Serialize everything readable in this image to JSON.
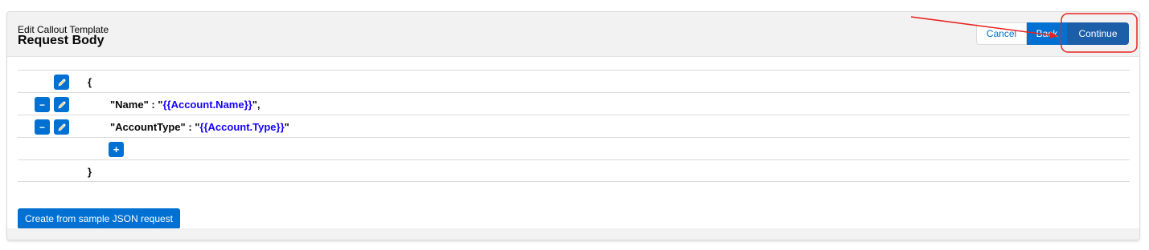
{
  "header": {
    "eyebrow": "Edit Callout Template",
    "title": "Request Body"
  },
  "actions": {
    "cancel_label": "Cancel",
    "back_label": "Back",
    "continue_label": "Continue"
  },
  "json_body": {
    "open_brace": "{",
    "close_brace": "}",
    "fields": [
      {
        "key_prefix": "\"Name\" : \"",
        "value": "{{Account.Name}}",
        "suffix": "\","
      },
      {
        "key_prefix": "\"AccountType\" : \"",
        "value": "{{Account.Type}}",
        "suffix": "\""
      }
    ]
  },
  "icons": {
    "minus": "−",
    "plus": "+",
    "edit": "pencil-icon"
  },
  "sample_button_label": "Create from sample JSON request",
  "colors": {
    "brand": "#0070d2",
    "variable_text": "#1500ff",
    "annotation": "#e8231f"
  }
}
